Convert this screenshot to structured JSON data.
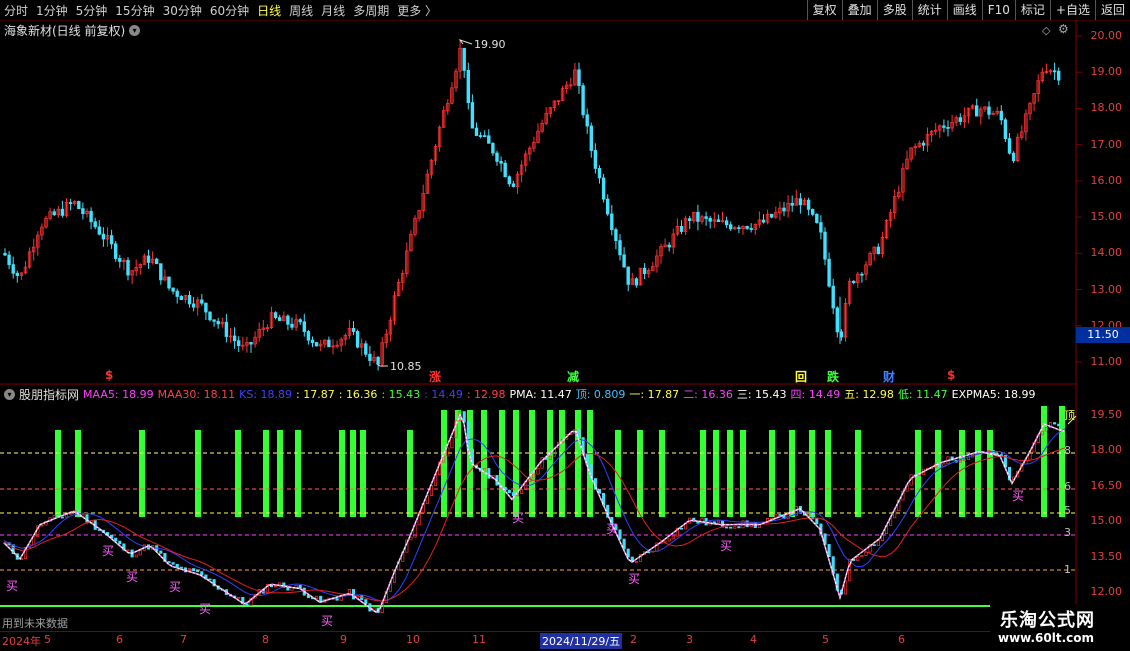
{
  "toolbar": {
    "periods": [
      "分时",
      "1分钟",
      "5分钟",
      "15分钟",
      "30分钟",
      "60分钟",
      "日线",
      "周线",
      "月线",
      "多周期",
      "更多 〉"
    ],
    "active_period": "日线",
    "actions": [
      "复权",
      "叠加",
      "多股",
      "统计",
      "画线",
      "F10",
      "标记",
      "+自选",
      "返回"
    ]
  },
  "main": {
    "title": "海象新材(日线 前复权)",
    "high_label": "19.90",
    "low_label": "10.85",
    "price_badge": "11.50",
    "y_ticks": [
      "20.00",
      "19.00",
      "18.00",
      "17.00",
      "16.00",
      "15.00",
      "14.00",
      "13.00",
      "12.00",
      "11.00"
    ],
    "signals": [
      {
        "text": "$",
        "color": "#ff3030",
        "x": 110
      },
      {
        "text": "涨",
        "color": "#ff3030",
        "x": 434
      },
      {
        "text": "减",
        "color": "#40ff40",
        "x": 572
      },
      {
        "text": "回",
        "color": "#ffff40",
        "x": 800
      },
      {
        "text": "跌",
        "color": "#40ff40",
        "x": 832
      },
      {
        "text": "财",
        "color": "#4080ff",
        "x": 888
      },
      {
        "text": "$",
        "color": "#ff3030",
        "x": 952
      }
    ]
  },
  "indicator": {
    "name": "股朋指标网",
    "values": [
      {
        "label": "MAA5: ",
        "value": "18.99",
        "color": "#ff40ff"
      },
      {
        "label": "MAA30: ",
        "value": "18.11",
        "color": "#ff4040"
      },
      {
        "label": "KS: ",
        "value": "18.89",
        "color": "#4040ff"
      },
      {
        "label": ": ",
        "value": "17.87",
        "color": "#ffff40"
      },
      {
        "label": ": ",
        "value": "16.36",
        "color": "#ffff40"
      },
      {
        "label": ": ",
        "value": "15.43",
        "color": "#40ff40"
      },
      {
        "label": ": ",
        "value": "14.49",
        "color": "#4040ff"
      },
      {
        "label": ": ",
        "value": "12.98",
        "color": "#ff4040"
      },
      {
        "label": "PMA: ",
        "value": "11.47",
        "color": "#ffffff"
      },
      {
        "label": "顶: ",
        "value": "0.809",
        "color": "#40c0ff"
      },
      {
        "label": "一: ",
        "value": "17.87",
        "color": "#ffff40"
      },
      {
        "label": "二: ",
        "value": "16.36",
        "color": "#ff40ff"
      },
      {
        "label": "三: ",
        "value": "15.43",
        "color": "#ffffff"
      },
      {
        "label": "四: ",
        "value": "14.49",
        "color": "#ff40ff"
      },
      {
        "label": "五: ",
        "value": "12.98",
        "color": "#ffff40"
      },
      {
        "label": "低: ",
        "value": "11.47",
        "color": "#40ff40"
      },
      {
        "label": "EXPMA5: ",
        "value": "18.99",
        "color": "#ffffff"
      }
    ],
    "y_ticks": [
      "19.50",
      "18.00",
      "16.50",
      "15.00",
      "13.50",
      "12.00"
    ],
    "side_labels": [
      "顶",
      "8",
      "6",
      "5",
      "3",
      "1"
    ],
    "buy_label": "买",
    "future_note": "用到未来数据"
  },
  "dates": {
    "labels": [
      "2024年",
      "5",
      "6",
      "7",
      "8",
      "9",
      "10",
      "11",
      "2024/11/29/五",
      "2",
      "3",
      "4",
      "5",
      "6"
    ],
    "highlight": "2024/11/29/五"
  },
  "watermark": {
    "line1": "乐淘公式网",
    "line2": "www.60lt.com"
  },
  "colors": {
    "up": "#ff3030",
    "down": "#40e0ff",
    "bars": "#33ff33",
    "bg": "#000000"
  }
}
